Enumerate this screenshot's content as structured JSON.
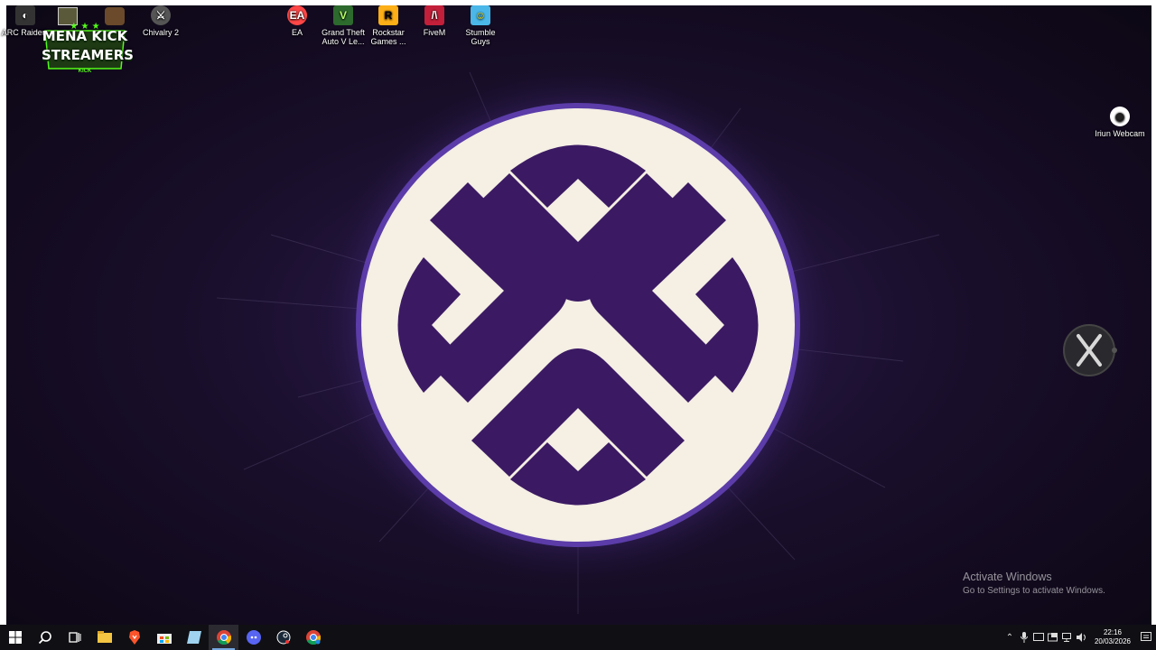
{
  "desktop_icons": {
    "arc_raiders": {
      "label": "ARC Raiders",
      "icon": "arc-raiders-icon"
    },
    "chivalry": {
      "label": "Chivalry 2",
      "icon": "chivalry-icon"
    },
    "ea": {
      "label": "EA",
      "icon": "ea-icon"
    },
    "gta": {
      "label": "Grand Theft Auto V Le...",
      "icon": "gta-v-icon"
    },
    "rockstar": {
      "label": "Rockstar Games ...",
      "icon": "rockstar-icon"
    },
    "fivem": {
      "label": "FiveM",
      "icon": "fivem-icon"
    },
    "stumble": {
      "label": "Stumble Guys",
      "icon": "stumble-guys-icon"
    },
    "iriun": {
      "label": "Iriun Webcam",
      "icon": "iriun-webcam-icon"
    }
  },
  "badge": {
    "line1": "MENA KICK",
    "line2": "STREAMERS",
    "sub": "KICK",
    "color": "#53fc18"
  },
  "watermark": {
    "title": "Activate Windows",
    "subtitle": "Go to Settings to activate Windows."
  },
  "clock": {
    "time": "22:16",
    "date": "20/03/2026"
  },
  "taskbar": {
    "items": [
      "start-icon",
      "search-icon",
      "task-view-icon",
      "file-explorer-icon",
      "brave-icon",
      "store-icon",
      "sticky-icon",
      "chrome-icon",
      "discord-icon",
      "steam-icon",
      "chrome-profile-icon"
    ],
    "active": "chrome-icon"
  },
  "colors": {
    "logo_purple": "#3b1a63",
    "logo_cream": "#f5efe4",
    "accent": "#76a8e0"
  }
}
